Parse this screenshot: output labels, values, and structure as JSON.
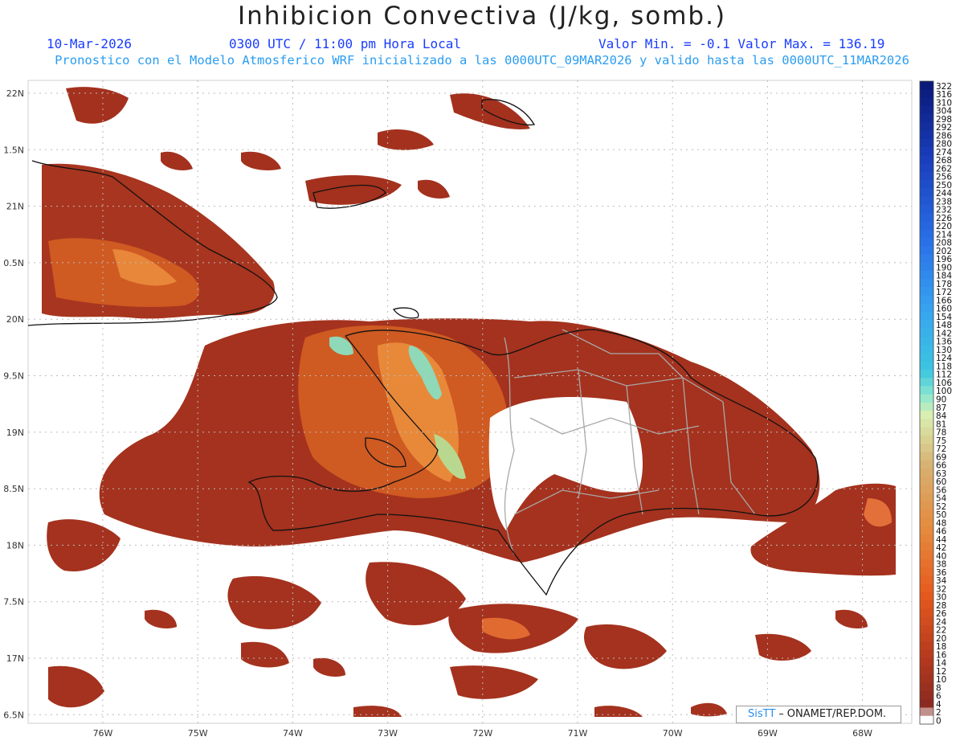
{
  "header": {
    "title": "Inhibicion Convectiva (J/kg, somb.)",
    "date": "10-Mar-2026",
    "time": "0300 UTC / 11:00 pm Hora Local",
    "minmax": "Valor Min. = -0.1  Valor Max. = 136.19",
    "subtitle": "Pronostico con el Modelo Atmosferico WRF inicializado a las 0000UTC_09MAR2026 y valido hasta las  0000UTC_11MAR2026"
  },
  "map": {
    "lat_labels": [
      "22N",
      "1.5N",
      "21N",
      "0.5N",
      "20N",
      "9.5N",
      "19N",
      "8.5N",
      "18N",
      "7.5N",
      "17N",
      "6.5N"
    ],
    "lon_labels": [
      "76W",
      "75W",
      "74W",
      "73W",
      "72W",
      "71W",
      "70W",
      "69W",
      "68W"
    ],
    "fill_colors": {
      "low": "#9a2d1e",
      "mid": "#d2551c",
      "high": "#e8822c",
      "peak": "#8fd8b8",
      "top": "#5ad0c8"
    },
    "coast_color": "#111111",
    "border_color": "#a8a8a8"
  },
  "colorbar": {
    "labels": [
      "322",
      "316",
      "310",
      "304",
      "298",
      "292",
      "286",
      "280",
      "274",
      "268",
      "262",
      "256",
      "250",
      "244",
      "238",
      "232",
      "226",
      "220",
      "214",
      "208",
      "202",
      "196",
      "190",
      "184",
      "178",
      "172",
      "166",
      "160",
      "154",
      "148",
      "142",
      "136",
      "130",
      "124",
      "118",
      "112",
      "106",
      "100",
      "90",
      "87",
      "84",
      "81",
      "78",
      "75",
      "72",
      "69",
      "66",
      "63",
      "60",
      "56",
      "54",
      "52",
      "50",
      "48",
      "46",
      "44",
      "42",
      "40",
      "38",
      "36",
      "34",
      "32",
      "30",
      "28",
      "26",
      "24",
      "22",
      "20",
      "18",
      "16",
      "14",
      "12",
      "10",
      "8",
      "6",
      "4",
      "2",
      "0"
    ]
  },
  "credit": {
    "brand": "SisTT",
    "text": "ONAMET/REP.DOM."
  }
}
